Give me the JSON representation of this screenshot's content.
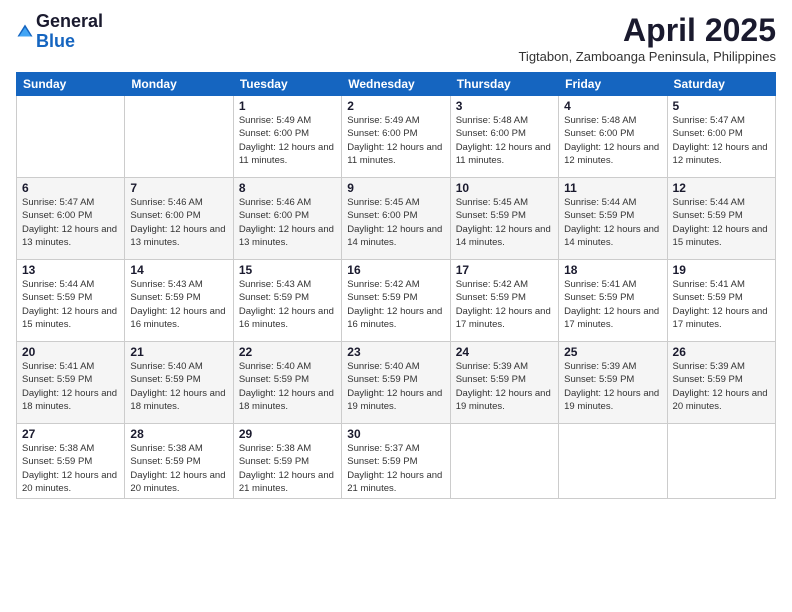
{
  "logo": {
    "general": "General",
    "blue": "Blue"
  },
  "title": {
    "month_year": "April 2025",
    "location": "Tigtabon, Zamboanga Peninsula, Philippines"
  },
  "days_of_week": [
    "Sunday",
    "Monday",
    "Tuesday",
    "Wednesday",
    "Thursday",
    "Friday",
    "Saturday"
  ],
  "weeks": [
    [
      {
        "day": "",
        "info": ""
      },
      {
        "day": "",
        "info": ""
      },
      {
        "day": "1",
        "info": "Sunrise: 5:49 AM\nSunset: 6:00 PM\nDaylight: 12 hours and 11 minutes."
      },
      {
        "day": "2",
        "info": "Sunrise: 5:49 AM\nSunset: 6:00 PM\nDaylight: 12 hours and 11 minutes."
      },
      {
        "day": "3",
        "info": "Sunrise: 5:48 AM\nSunset: 6:00 PM\nDaylight: 12 hours and 11 minutes."
      },
      {
        "day": "4",
        "info": "Sunrise: 5:48 AM\nSunset: 6:00 PM\nDaylight: 12 hours and 12 minutes."
      },
      {
        "day": "5",
        "info": "Sunrise: 5:47 AM\nSunset: 6:00 PM\nDaylight: 12 hours and 12 minutes."
      }
    ],
    [
      {
        "day": "6",
        "info": "Sunrise: 5:47 AM\nSunset: 6:00 PM\nDaylight: 12 hours and 13 minutes."
      },
      {
        "day": "7",
        "info": "Sunrise: 5:46 AM\nSunset: 6:00 PM\nDaylight: 12 hours and 13 minutes."
      },
      {
        "day": "8",
        "info": "Sunrise: 5:46 AM\nSunset: 6:00 PM\nDaylight: 12 hours and 13 minutes."
      },
      {
        "day": "9",
        "info": "Sunrise: 5:45 AM\nSunset: 6:00 PM\nDaylight: 12 hours and 14 minutes."
      },
      {
        "day": "10",
        "info": "Sunrise: 5:45 AM\nSunset: 5:59 PM\nDaylight: 12 hours and 14 minutes."
      },
      {
        "day": "11",
        "info": "Sunrise: 5:44 AM\nSunset: 5:59 PM\nDaylight: 12 hours and 14 minutes."
      },
      {
        "day": "12",
        "info": "Sunrise: 5:44 AM\nSunset: 5:59 PM\nDaylight: 12 hours and 15 minutes."
      }
    ],
    [
      {
        "day": "13",
        "info": "Sunrise: 5:44 AM\nSunset: 5:59 PM\nDaylight: 12 hours and 15 minutes."
      },
      {
        "day": "14",
        "info": "Sunrise: 5:43 AM\nSunset: 5:59 PM\nDaylight: 12 hours and 16 minutes."
      },
      {
        "day": "15",
        "info": "Sunrise: 5:43 AM\nSunset: 5:59 PM\nDaylight: 12 hours and 16 minutes."
      },
      {
        "day": "16",
        "info": "Sunrise: 5:42 AM\nSunset: 5:59 PM\nDaylight: 12 hours and 16 minutes."
      },
      {
        "day": "17",
        "info": "Sunrise: 5:42 AM\nSunset: 5:59 PM\nDaylight: 12 hours and 17 minutes."
      },
      {
        "day": "18",
        "info": "Sunrise: 5:41 AM\nSunset: 5:59 PM\nDaylight: 12 hours and 17 minutes."
      },
      {
        "day": "19",
        "info": "Sunrise: 5:41 AM\nSunset: 5:59 PM\nDaylight: 12 hours and 17 minutes."
      }
    ],
    [
      {
        "day": "20",
        "info": "Sunrise: 5:41 AM\nSunset: 5:59 PM\nDaylight: 12 hours and 18 minutes."
      },
      {
        "day": "21",
        "info": "Sunrise: 5:40 AM\nSunset: 5:59 PM\nDaylight: 12 hours and 18 minutes."
      },
      {
        "day": "22",
        "info": "Sunrise: 5:40 AM\nSunset: 5:59 PM\nDaylight: 12 hours and 18 minutes."
      },
      {
        "day": "23",
        "info": "Sunrise: 5:40 AM\nSunset: 5:59 PM\nDaylight: 12 hours and 19 minutes."
      },
      {
        "day": "24",
        "info": "Sunrise: 5:39 AM\nSunset: 5:59 PM\nDaylight: 12 hours and 19 minutes."
      },
      {
        "day": "25",
        "info": "Sunrise: 5:39 AM\nSunset: 5:59 PM\nDaylight: 12 hours and 19 minutes."
      },
      {
        "day": "26",
        "info": "Sunrise: 5:39 AM\nSunset: 5:59 PM\nDaylight: 12 hours and 20 minutes."
      }
    ],
    [
      {
        "day": "27",
        "info": "Sunrise: 5:38 AM\nSunset: 5:59 PM\nDaylight: 12 hours and 20 minutes."
      },
      {
        "day": "28",
        "info": "Sunrise: 5:38 AM\nSunset: 5:59 PM\nDaylight: 12 hours and 20 minutes."
      },
      {
        "day": "29",
        "info": "Sunrise: 5:38 AM\nSunset: 5:59 PM\nDaylight: 12 hours and 21 minutes."
      },
      {
        "day": "30",
        "info": "Sunrise: 5:37 AM\nSunset: 5:59 PM\nDaylight: 12 hours and 21 minutes."
      },
      {
        "day": "",
        "info": ""
      },
      {
        "day": "",
        "info": ""
      },
      {
        "day": "",
        "info": ""
      }
    ]
  ]
}
